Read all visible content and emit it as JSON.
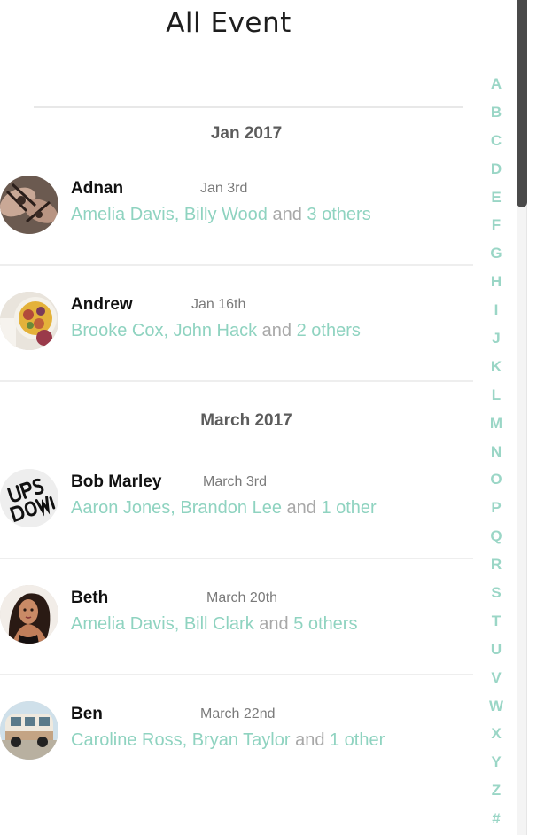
{
  "header": {
    "title": "All Event"
  },
  "sections": [
    {
      "label": "Jan 2017",
      "events": [
        {
          "name": "Adnan",
          "date": "Jan 3rd",
          "names": "Amelia Davis, Billy Wood",
          "and": " and ",
          "others": "3 others",
          "avatar": "tattoo-photo-icon"
        },
        {
          "name": "Andrew",
          "date": "Jan 16th",
          "names": "Brooke Cox, John Hack",
          "and": " and ",
          "others": "2 others",
          "avatar": "food-bowl-photo-icon"
        }
      ]
    },
    {
      "label": "March 2017",
      "events": [
        {
          "name": "Bob Marley",
          "date": "March 3rd",
          "names": "Aaron Jones, Brandon Lee",
          "and": " and ",
          "others": "1 other",
          "avatar": "ups-downs-logo-icon"
        },
        {
          "name": "Beth",
          "date": "March 20th",
          "names": "Amelia Davis, Bill Clark",
          "and": " and ",
          "others": "5 others",
          "avatar": "woman-portrait-icon"
        },
        {
          "name": "Ben",
          "date": "March 22nd",
          "names": "Caroline Ross, Bryan Taylor",
          "and": " and ",
          "others": "1 other",
          "avatar": "camper-van-photo-icon"
        }
      ]
    }
  ],
  "index_letters": [
    "A",
    "B",
    "C",
    "D",
    "E",
    "F",
    "G",
    "H",
    "I",
    "J",
    "K",
    "L",
    "M",
    "N",
    "O",
    "P",
    "Q",
    "R",
    "S",
    "T",
    "U",
    "V",
    "W",
    "X",
    "Y",
    "Z",
    "#"
  ],
  "colors": {
    "accent": "#8fd3c0",
    "index": "#9ad6c6",
    "muted": "#a8a8a8",
    "scroll_thumb": "#4a4a4a"
  }
}
